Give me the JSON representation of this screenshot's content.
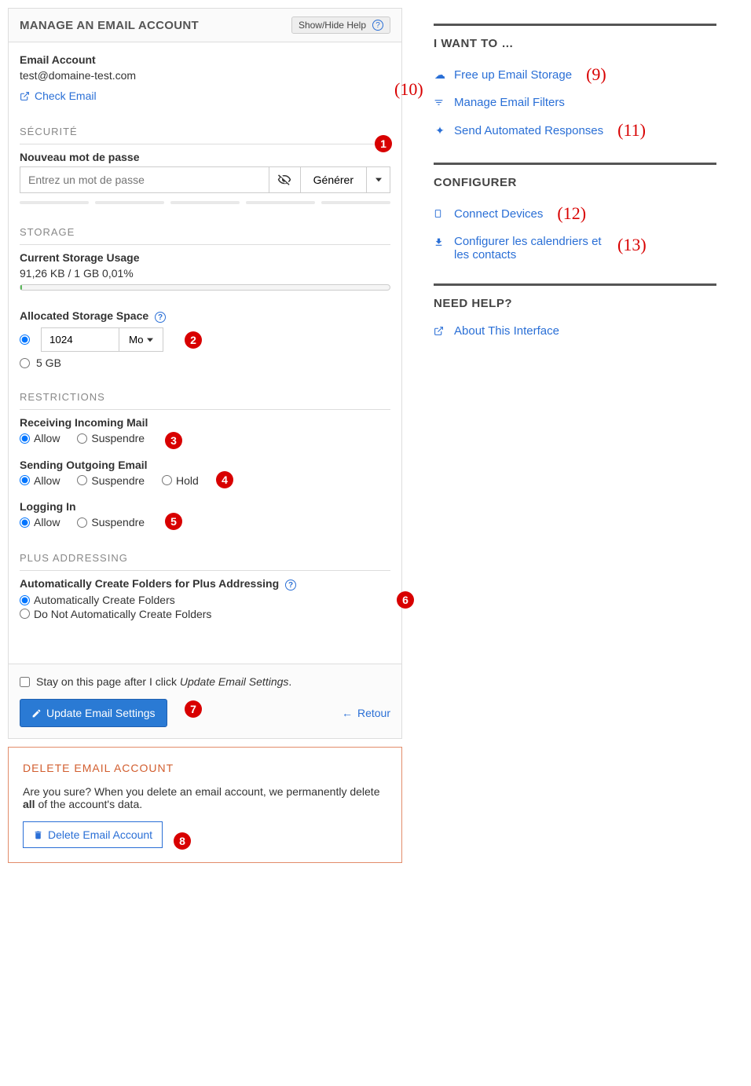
{
  "header": {
    "title": "MANAGE AN EMAIL ACCOUNT",
    "help_btn": "Show/Hide Help"
  },
  "account": {
    "label": "Email Account",
    "value": "test@domaine-test.com",
    "check_email": "Check Email"
  },
  "security": {
    "title": "SÉCURITÉ",
    "password_label": "Nouveau mot de passe",
    "password_placeholder": "Entrez un mot de passe",
    "generate": "Générer"
  },
  "storage": {
    "title": "STORAGE",
    "usage_label": "Current Storage Usage",
    "usage_value": "91,26 KB / 1 GB 0,01%",
    "alloc_label": "Allocated Storage Space",
    "quota_value": "1024",
    "unit": "Mo",
    "max_option": "5 GB"
  },
  "restrictions": {
    "title": "RESTRICTIONS",
    "incoming_label": "Receiving Incoming Mail",
    "outgoing_label": "Sending Outgoing Email",
    "login_label": "Logging In",
    "allow": "Allow",
    "suspend": "Suspendre",
    "hold": "Hold"
  },
  "plus": {
    "title": "PLUS ADDRESSING",
    "label": "Automatically Create Folders for Plus Addressing",
    "opt_yes": "Automatically Create Folders",
    "opt_no": "Do Not Automatically Create Folders"
  },
  "footer": {
    "stay_prefix": "Stay on this page after I click ",
    "stay_em": "Update Email Settings",
    "update_btn": "Update Email Settings",
    "back": "Retour"
  },
  "delete": {
    "title": "DELETE EMAIL ACCOUNT",
    "confirm_prefix": "Are you sure? When you delete an email account, we permanently delete ",
    "confirm_bold": "all",
    "confirm_suffix": " of the account's data.",
    "button": "Delete Email Account"
  },
  "side": {
    "want_title": "I WANT TO …",
    "free_storage": "Free up Email Storage",
    "filters": "Manage Email Filters",
    "auto_resp": "Send Automated Responses",
    "config_title": "CONFIGURER",
    "connect": "Connect Devices",
    "cal_contacts": "Configurer les calendriers et les contacts",
    "help_title": "NEED HELP?",
    "about": "About This Interface"
  }
}
